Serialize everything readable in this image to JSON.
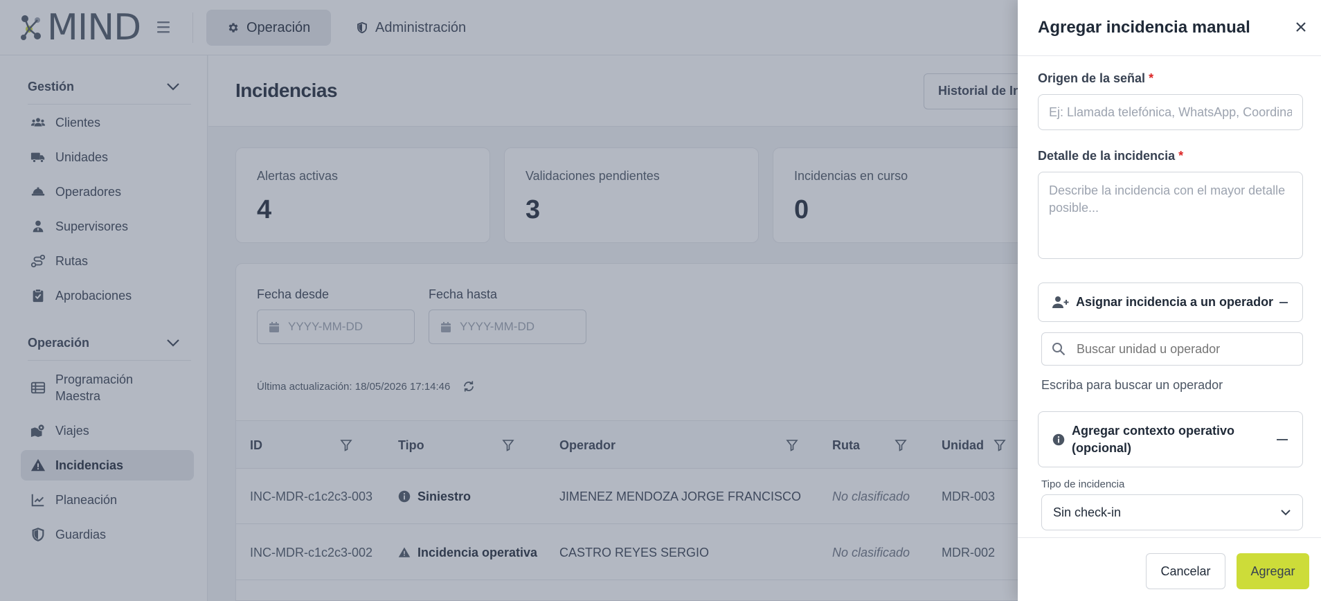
{
  "app": {
    "logo_text": "MIND"
  },
  "topnav": {
    "tabs": [
      {
        "label": "Operación",
        "icon": "gear-icon",
        "active": true
      },
      {
        "label": "Administración",
        "icon": "shield-icon",
        "active": false
      }
    ]
  },
  "sidebar": {
    "sections": [
      {
        "title": "Gestión",
        "items": [
          {
            "label": "Clientes",
            "icon": "users-icon"
          },
          {
            "label": "Unidades",
            "icon": "truck-icon"
          },
          {
            "label": "Operadores",
            "icon": "hard-hat-icon"
          },
          {
            "label": "Supervisores",
            "icon": "user-tie-icon"
          },
          {
            "label": "Rutas",
            "icon": "route-icon"
          },
          {
            "label": "Aprobaciones",
            "icon": "clipboard-check-icon"
          }
        ]
      },
      {
        "title": "Operación",
        "items": [
          {
            "label": "Programación Maestra",
            "icon": "table-list-icon"
          },
          {
            "label": "Viajes",
            "icon": "map-location-icon"
          },
          {
            "label": "Incidencias",
            "icon": "warning-icon",
            "active": true
          },
          {
            "label": "Planeación",
            "icon": "chart-line-icon"
          },
          {
            "label": "Guardias",
            "icon": "shield-icon"
          }
        ]
      }
    ]
  },
  "page": {
    "title": "Incidencias",
    "history_button": "Historial de In"
  },
  "stats": [
    {
      "label": "Alertas activas",
      "value": "4"
    },
    {
      "label": "Validaciones pendientes",
      "value": "3"
    },
    {
      "label": "Incidencias en curso",
      "value": "0"
    }
  ],
  "filters": {
    "from_label": "Fecha desde",
    "to_label": "Fecha hasta",
    "date_placeholder": "YYYY-MM-DD",
    "last_update": "Última actualización: 18/05/2026 17:14:46"
  },
  "table": {
    "columns": [
      "ID",
      "Tipo",
      "Operador",
      "Ruta",
      "Unidad"
    ],
    "rows": [
      {
        "id": "INC-MDR-c1c2c3-003",
        "tipo": "Siniestro",
        "tipo_icon": "info-circle-icon",
        "operador": "JIMENEZ MENDOZA JORGE FRANCISCO",
        "ruta": "No clasificado",
        "unidad": "MDR-003"
      },
      {
        "id": "INC-MDR-c1c2c3-002",
        "tipo": "Incidencia operativa",
        "tipo_icon": "warning-icon",
        "operador": "CASTRO REYES SERGIO",
        "ruta": "No clasificado",
        "unidad": "MDR-002"
      }
    ]
  },
  "drawer": {
    "title": "Agregar incidencia manual",
    "origin_label": "Origen de la señal",
    "origin_placeholder": "Ej: Llamada telefónica, WhatsApp, Coordinación...",
    "detail_label": "Detalle de la incidencia",
    "detail_placeholder": "Describe la incidencia con el mayor detalle posible...",
    "required_mark": "*",
    "assign_title": "Asignar incidencia a un operador",
    "search_placeholder": "Buscar unidad u operador",
    "search_hint": "Escriba para buscar un operador",
    "context_title": "Agregar contexto operativo (opcional)",
    "type_label": "Tipo de incidencia",
    "type_value": "Sin check-in",
    "cancel": "Cancelar",
    "submit": "Agregar"
  },
  "colors": {
    "accent": "#cddc39",
    "required": "#dc2626",
    "overlay": "#4b556e"
  }
}
